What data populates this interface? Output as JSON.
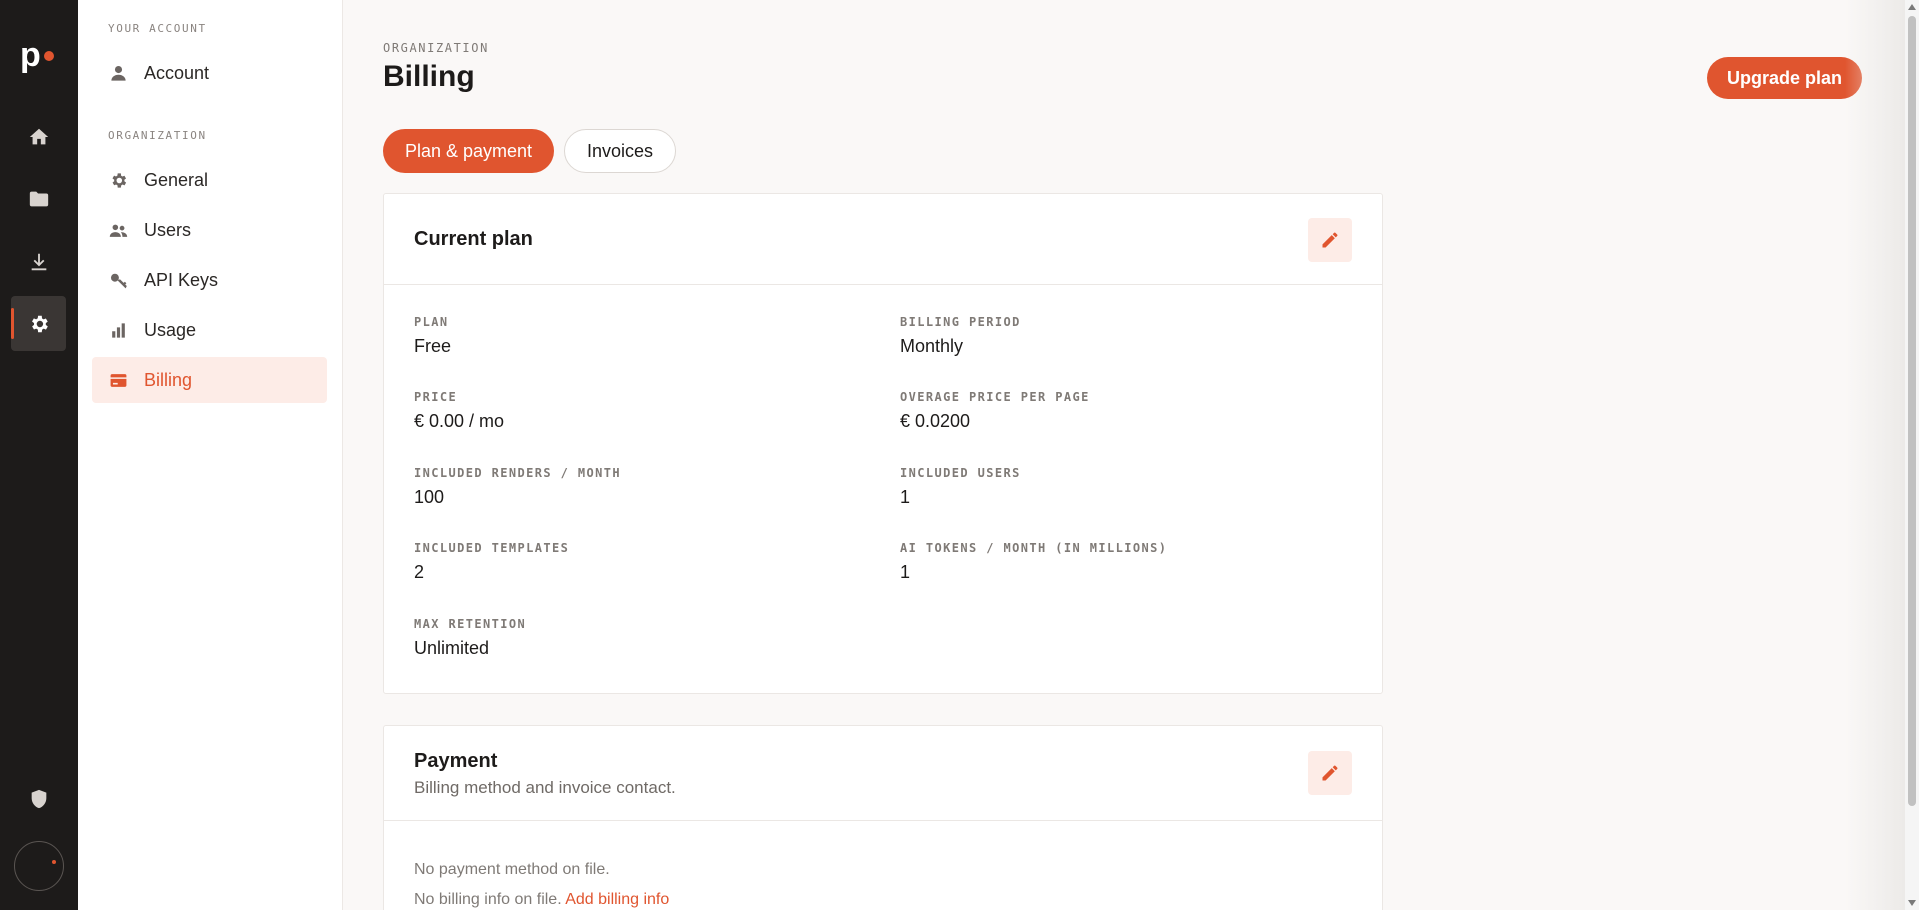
{
  "brand": {
    "logo_letter": "p"
  },
  "rail": {
    "items": [
      {
        "icon": "home-icon"
      },
      {
        "icon": "folder-icon"
      },
      {
        "icon": "download-icon"
      },
      {
        "icon": "gear-icon",
        "active": true
      },
      {
        "icon": "shield-icon"
      }
    ]
  },
  "sidebar": {
    "account_section": "YOUR ACCOUNT",
    "account_item": "Account",
    "org_section": "ORGANIZATION",
    "items": [
      {
        "label": "General",
        "icon": "gear-icon"
      },
      {
        "label": "Users",
        "icon": "users-icon"
      },
      {
        "label": "API Keys",
        "icon": "key-icon"
      },
      {
        "label": "Usage",
        "icon": "bar-chart-icon"
      },
      {
        "label": "Billing",
        "icon": "credit-card-icon",
        "active": true
      }
    ]
  },
  "header": {
    "section": "ORGANIZATION",
    "title": "Billing",
    "upgrade_label": "Upgrade plan"
  },
  "tabs": [
    {
      "label": "Plan & payment",
      "active": true
    },
    {
      "label": "Invoices",
      "active": false
    }
  ],
  "current_plan": {
    "title": "Current plan",
    "fields": [
      {
        "label": "PLAN",
        "value": "Free"
      },
      {
        "label": "BILLING PERIOD",
        "value": "Monthly"
      },
      {
        "label": "PRICE",
        "value": "€ 0.00 / mo"
      },
      {
        "label": "OVERAGE PRICE PER PAGE",
        "value": "€ 0.0200"
      },
      {
        "label": "INCLUDED RENDERS / MONTH",
        "value": "100"
      },
      {
        "label": "INCLUDED USERS",
        "value": "1"
      },
      {
        "label": "INCLUDED TEMPLATES",
        "value": "2"
      },
      {
        "label": "AI TOKENS / MONTH (IN MILLIONS)",
        "value": "1"
      },
      {
        "label": "MAX RETENTION",
        "value": "Unlimited"
      }
    ]
  },
  "payment": {
    "title": "Payment",
    "subtitle": "Billing method and invoice contact.",
    "no_method": "No payment method on file.",
    "no_billing": "No billing info on file.",
    "add_billing_link": "Add billing info"
  },
  "colors": {
    "accent": "#e0552f",
    "rail_bg": "#1d1b1a",
    "page_bg": "#faf8f7"
  }
}
